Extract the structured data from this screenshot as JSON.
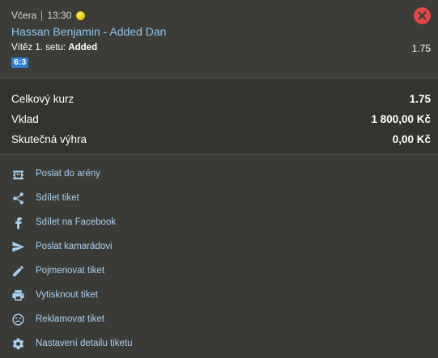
{
  "bet": {
    "day": "Včera",
    "time": "13:30",
    "match": "Hassan Benjamin - Added Dan",
    "market_label": "Vítěz 1. setu:",
    "selection": "Added",
    "odd": "1.75",
    "score": "6:3"
  },
  "summary": {
    "rows": [
      {
        "label": "Celkový kurz",
        "value": "1.75"
      },
      {
        "label": "Vklad",
        "value": "1 800,00 Kč"
      },
      {
        "label": "Skutečná výhra",
        "value": "0,00 Kč"
      }
    ]
  },
  "actions": [
    {
      "label": "Poslat do arény",
      "icon": "arena-icon"
    },
    {
      "label": "Sdílet tiket",
      "icon": "share-icon"
    },
    {
      "label": "Sdílet na Facebook",
      "icon": "facebook-icon"
    },
    {
      "label": "Poslat kamarádovi",
      "icon": "send-icon"
    },
    {
      "label": "Pojmenovat tiket",
      "icon": "pencil-icon"
    },
    {
      "label": "Vytisknout tiket",
      "icon": "printer-icon"
    },
    {
      "label": "Reklamovat tiket",
      "icon": "sad-face-icon"
    },
    {
      "label": "Nastavení detailu tiketu",
      "icon": "gear-icon"
    }
  ],
  "colors": {
    "accent": "#a9d2f4",
    "match_link": "#8ec8f2",
    "close": "#e04848",
    "score_badge": "#2f7fd0",
    "status_coin": "#e2c800"
  }
}
